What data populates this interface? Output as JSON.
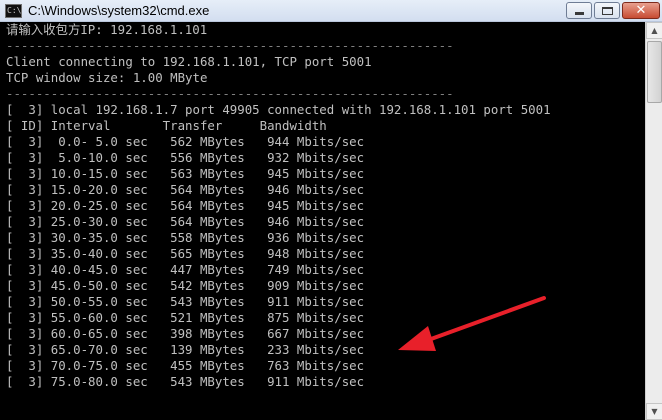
{
  "window": {
    "title": "C:\\Windows\\system32\\cmd.exe",
    "icon_name": "cmd-icon",
    "icon_text": "C:\\",
    "controls": {
      "minimize_icon": "minimize-icon",
      "maximize_icon": "maximize-icon",
      "close_glyph": "✕"
    }
  },
  "console": {
    "background": "#000000",
    "text_color": "#c0c0c0",
    "lines": [
      "请输入收包方IP: 192.168.1.101",
      "------------------------------------------------------------",
      "Client connecting to 192.168.1.101, TCP port 5001",
      "TCP window size: 1.00 MByte",
      "------------------------------------------------------------",
      "[  3] local 192.168.1.7 port 49905 connected with 192.168.1.101 port 5001",
      "[ ID] Interval       Transfer     Bandwidth",
      "[  3]  0.0- 5.0 sec   562 MBytes   944 Mbits/sec",
      "[  3]  5.0-10.0 sec   556 MBytes   932 Mbits/sec",
      "[  3] 10.0-15.0 sec   563 MBytes   945 Mbits/sec",
      "[  3] 15.0-20.0 sec   564 MBytes   946 Mbits/sec",
      "[  3] 20.0-25.0 sec   564 MBytes   945 Mbits/sec",
      "[  3] 25.0-30.0 sec   564 MBytes   946 Mbits/sec",
      "[  3] 30.0-35.0 sec   558 MBytes   936 Mbits/sec",
      "[  3] 35.0-40.0 sec   565 MBytes   948 Mbits/sec",
      "[  3] 40.0-45.0 sec   447 MBytes   749 Mbits/sec",
      "[  3] 45.0-50.0 sec   542 MBytes   909 Mbits/sec",
      "[  3] 50.0-55.0 sec   543 MBytes   911 Mbits/sec",
      "[  3] 55.0-60.0 sec   521 MBytes   875 Mbits/sec",
      "[  3] 60.0-65.0 sec   398 MBytes   667 Mbits/sec",
      "[  3] 65.0-70.0 sec   139 MBytes   233 Mbits/sec",
      "[  3] 70.0-75.0 sec   455 MBytes   763 Mbits/sec",
      "[  3] 75.0-80.0 sec   543 MBytes   911 Mbits/sec"
    ]
  },
  "annotation": {
    "type": "arrow",
    "color": "#e8202a",
    "points_to_line": 20
  },
  "scrollbar": {
    "up_icon": "scroll-up-icon",
    "down_icon": "scroll-down-icon"
  }
}
